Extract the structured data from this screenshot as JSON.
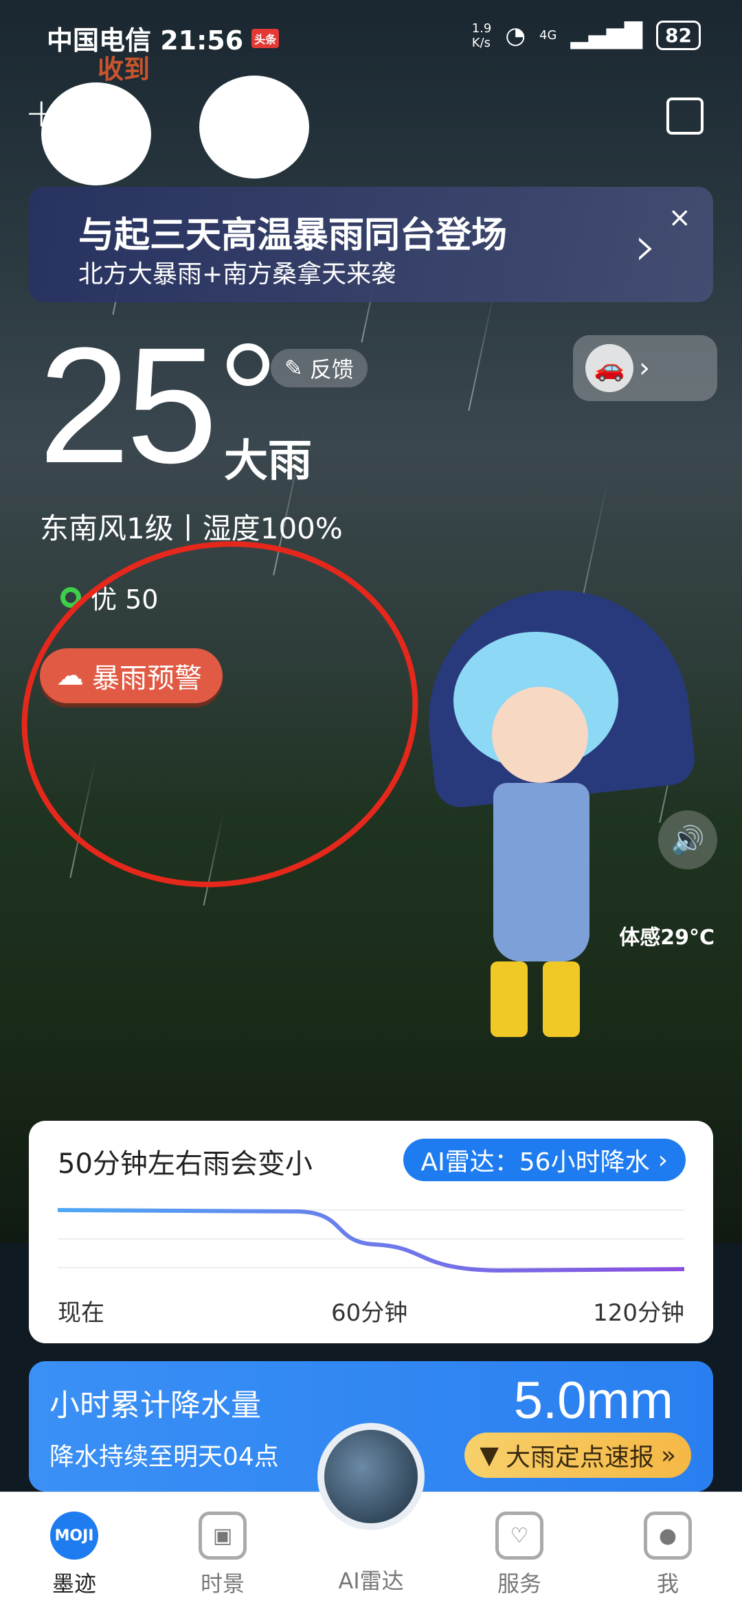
{
  "status_bar": {
    "carrier_time": "中国电信 21:56",
    "news_tag": "头条",
    "speed_top": "1.9",
    "speed_unit": "K/s",
    "network": "4G",
    "battery": "82"
  },
  "top_bar": {
    "add_label": "+",
    "location_icon": "location-pin-icon"
  },
  "sticker": {
    "text": "收到"
  },
  "banner": {
    "title": "与起三天高温暴雨同台登场",
    "subtitle": "北方大暴雨+南方桑拿天来袭",
    "close": "×",
    "arrow": "›"
  },
  "weather": {
    "temperature": "25",
    "condition": "大雨",
    "feedback_label": "反馈",
    "wind_humidity": "东南风1级丨湿度100%",
    "aqi": "优 50",
    "warning": "暴雨预警",
    "feels_like": "体感29°C"
  },
  "rain_card": {
    "headline": "50分钟左右雨会变小",
    "radar_button": "AI雷达：56小时降水",
    "axis": [
      "现在",
      "60分钟",
      "120分钟"
    ]
  },
  "precip_card": {
    "title": "小时累计降水量",
    "subtitle": "降水持续至明天04点",
    "value": "5.0mm",
    "report_button": "大雨定点速报"
  },
  "nav": {
    "items": [
      {
        "label": "墨迹",
        "icon": "MOJI"
      },
      {
        "label": "时景",
        "icon": "▣"
      },
      {
        "label": "AI雷达",
        "icon": ""
      },
      {
        "label": "服务",
        "icon": "♡"
      },
      {
        "label": "我",
        "icon": "●"
      }
    ]
  },
  "colors": {
    "accent": "#1e7cf0",
    "warning": "#e15a44",
    "annotation": "#e6281c"
  }
}
